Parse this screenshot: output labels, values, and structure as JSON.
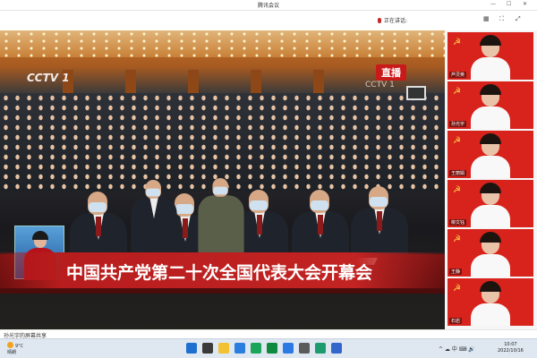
{
  "window": {
    "title": "腾讯会议",
    "minimize": "—",
    "maximize": "☐",
    "close": "✕"
  },
  "topbar": {
    "speaking_label": "正在讲话:",
    "icons": [
      "▦",
      "⛶",
      "⤢"
    ]
  },
  "stage": {
    "logo": "CCTV 1",
    "live_badge": "直播",
    "channel": "CCTV 1",
    "caption": "中国共产党第二十次全国代表大会开幕会"
  },
  "participants": [
    {
      "name": "芦灵英"
    },
    {
      "name": "孙光宇"
    },
    {
      "name": "王丽娟"
    },
    {
      "name": "柳文钰"
    },
    {
      "name": "王静"
    },
    {
      "name": "石岩"
    }
  ],
  "status": {
    "screen_share": "孙光宇的屏幕共享"
  },
  "taskbar": {
    "temperature": "9°C",
    "weather": "晴朗",
    "tray": "^ ☁ 中 ⌨ 🔊",
    "time": "10:07",
    "date": "2022/10/16",
    "colors": [
      "#1f6fd1",
      "#3a3a3a",
      "#f2c232",
      "#2b7de0",
      "#1aa55a",
      "#0d8a3e",
      "#2c7be5",
      "#5b5b5b",
      "#1c9b6e",
      "#3366cc"
    ]
  }
}
